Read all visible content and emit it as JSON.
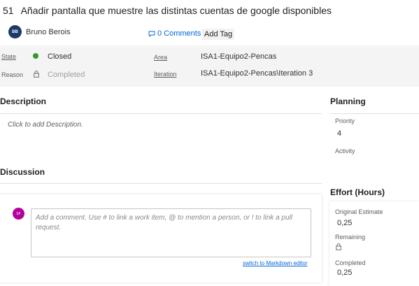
{
  "work_item": {
    "id": "51",
    "title": "Añadir pantalla que muestre las distintas cuentas de google disponibles"
  },
  "author": {
    "initials": "BB",
    "name": "Bruno Berois"
  },
  "toolbar": {
    "comments_label": "0 Comments",
    "add_tag_label": "Add Tag"
  },
  "fields": {
    "state_label": "State",
    "state_value": "Closed",
    "state_color": "#339933",
    "reason_label": "Reason",
    "reason_value": "Completed",
    "area_label": "Area",
    "area_value": "ISA1-Equipo2-Pencas",
    "iteration_label": "Iteration",
    "iteration_value": "ISA1-Equipo2-Pencas\\Iteration 3"
  },
  "description": {
    "title": "Description",
    "placeholder": "Click to add Description."
  },
  "discussion": {
    "title": "Discussion",
    "user_initials": "SF",
    "comment_placeholder": "Add a comment. Use # to link a work item, @ to mention a person, or ! to link a pull request.",
    "markdown_link": "switch to Markdown editor"
  },
  "planning": {
    "title": "Planning",
    "priority_label": "Priority",
    "priority_value": "4",
    "activity_label": "Activity"
  },
  "effort": {
    "title": "Effort (Hours)",
    "original_estimate_label": "Original Estimate",
    "original_estimate_value": "0,25",
    "remaining_label": "Remaining",
    "completed_label": "Completed",
    "completed_value": "0,25"
  }
}
